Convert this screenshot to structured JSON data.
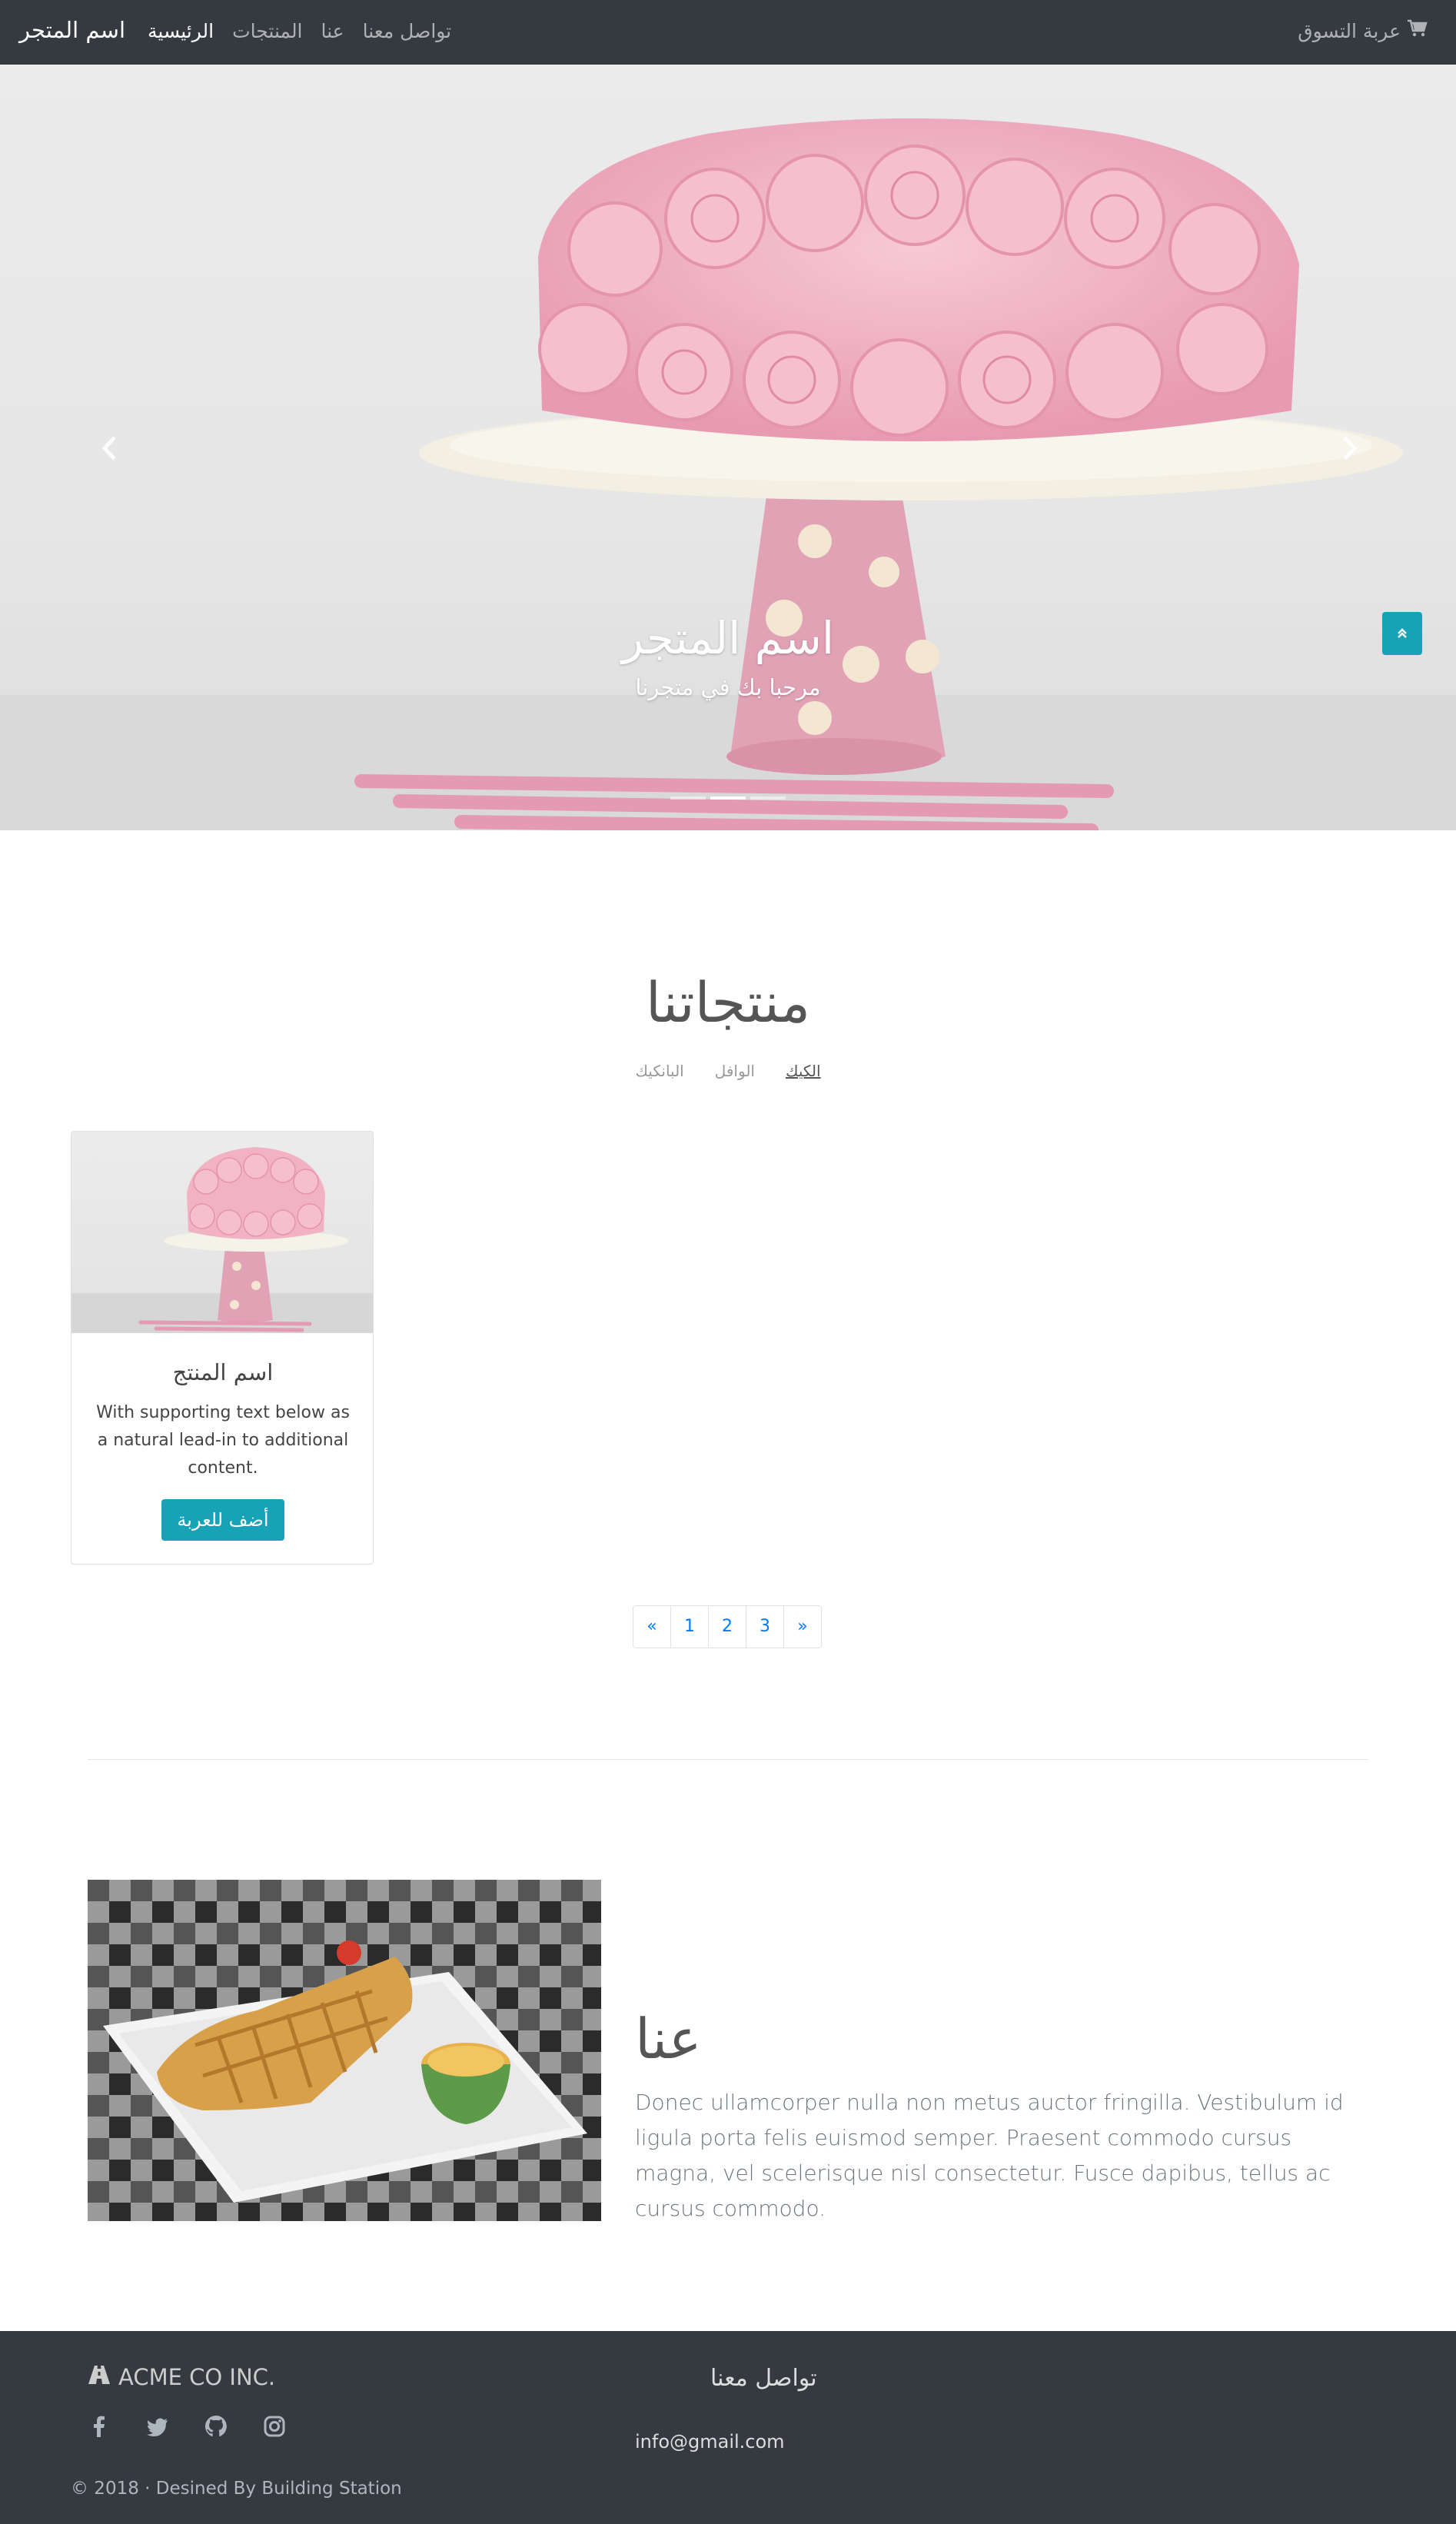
{
  "navbar": {
    "brand": "اسم المتجر",
    "links": [
      "الرئيسية",
      "المنتجات",
      "عنا",
      "تواصل معنا"
    ],
    "cart_label": "عربة التسوق"
  },
  "hero": {
    "title": "اسم المتجر",
    "subtitle": "مرحبا بك في متجرنا",
    "slide_count": 3,
    "active_slide": 2
  },
  "products": {
    "title": "منتجاتنا",
    "filters": [
      "الكيك",
      "الوافل",
      "البانكيك"
    ],
    "active_filter": "الكيك",
    "card": {
      "title": "اسم المنتج",
      "text": "With supporting text below as a natural lead-in to additional content.",
      "button": "أضف للعربة"
    },
    "pagination": [
      "«",
      "1",
      "2",
      "3",
      "»"
    ]
  },
  "about": {
    "title": "عنا",
    "text": "Donec ullamcorper nulla non metus auctor fringilla. Vestibulum id ligula porta felis euismod semper. Praesent commodo cursus magna, vel scelerisque nisl consectetur. Fusce dapibus, tellus ac cursus commodo."
  },
  "footer": {
    "company": "ACME CO INC.",
    "social": [
      "facebook-icon",
      "twitter-icon",
      "github-icon",
      "instagram-icon"
    ],
    "contact_title": "تواصل معنا",
    "email": "info@gmail.com",
    "copyright": "© 2018 · Desined By Building Station"
  },
  "colors": {
    "navbar_bg": "#343a40",
    "accent": "#17a2b8",
    "link": "#007bff"
  }
}
